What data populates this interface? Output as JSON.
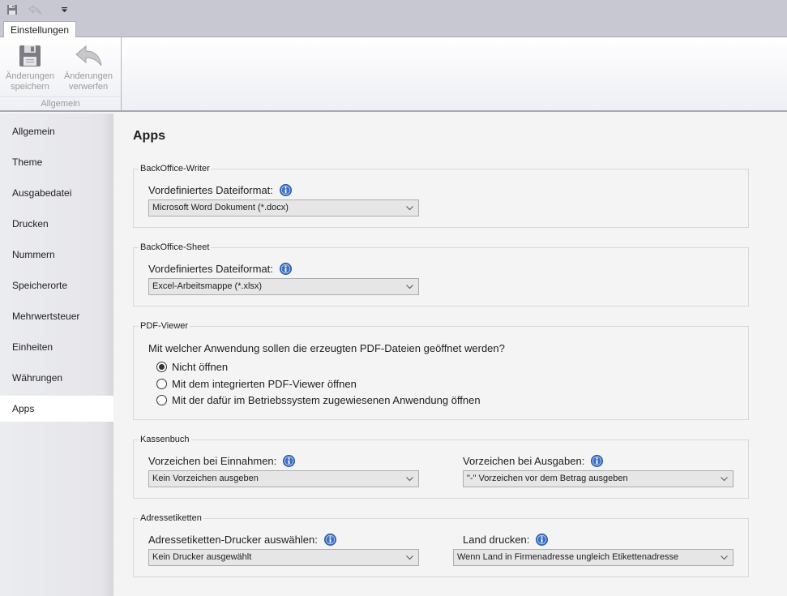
{
  "quick_access": {
    "icons": [
      "save-icon",
      "undo-icon",
      "customize-dropdown-icon"
    ]
  },
  "ribbon": {
    "tab_label": "Einstellungen",
    "group_label": "Allgemein",
    "buttons": [
      {
        "label_line1": "Änderungen",
        "label_line2": "speichern",
        "icon": "floppy-disk-icon",
        "enabled": false
      },
      {
        "label_line1": "Änderungen",
        "label_line2": "verwerfen",
        "icon": "undo-arrow-icon",
        "enabled": false
      }
    ]
  },
  "sidebar": {
    "items": [
      {
        "label": "Allgemein"
      },
      {
        "label": "Theme"
      },
      {
        "label": "Ausgabedatei"
      },
      {
        "label": "Drucken"
      },
      {
        "label": "Nummern"
      },
      {
        "label": "Speicherorte"
      },
      {
        "label": "Mehrwertsteuer"
      },
      {
        "label": "Einheiten"
      },
      {
        "label": "Währungen"
      },
      {
        "label": "Apps",
        "active": true
      }
    ]
  },
  "main": {
    "title": "Apps",
    "writer": {
      "legend": "BackOffice-Writer",
      "label": "Vordefiniertes Dateiformat:",
      "value": "Microsoft Word Dokument (*.docx)"
    },
    "sheet": {
      "legend": "BackOffice-Sheet",
      "label": "Vordefiniertes Dateiformat:",
      "value": "Excel-Arbeitsmappe (*.xlsx)"
    },
    "pdf": {
      "legend": "PDF-Viewer",
      "question": "Mit welcher Anwendung sollen die erzeugten PDF-Dateien geöffnet werden?",
      "options": [
        {
          "label": "Nicht öffnen",
          "checked": true
        },
        {
          "label": "Mit dem integrierten PDF-Viewer öffnen",
          "checked": false
        },
        {
          "label": "Mit der dafür im Betriebssystem zugewiesenen Anwendung öffnen",
          "checked": false
        }
      ]
    },
    "kassenbuch": {
      "legend": "Kassenbuch",
      "income_label": "Vorzeichen bei Einnahmen:",
      "income_value": "Kein Vorzeichen ausgeben",
      "expense_label": "Vorzeichen bei Ausgaben:",
      "expense_value": "\"-\" Vorzeichen vor dem Betrag ausgeben"
    },
    "adressetiketten": {
      "legend": "Adressetiketten",
      "printer_label": "Adressetiketten-Drucker auswählen:",
      "printer_value": "Kein Drucker ausgewählt",
      "country_label": "Land drucken:",
      "country_value": "Wenn Land in Firmenadresse ungleich Etikettenadresse"
    }
  },
  "colors": {
    "info_icon": "#3a6fc4",
    "active_nav_bg": "#ffffff",
    "sidebar_bg": "#e8e8ec"
  }
}
